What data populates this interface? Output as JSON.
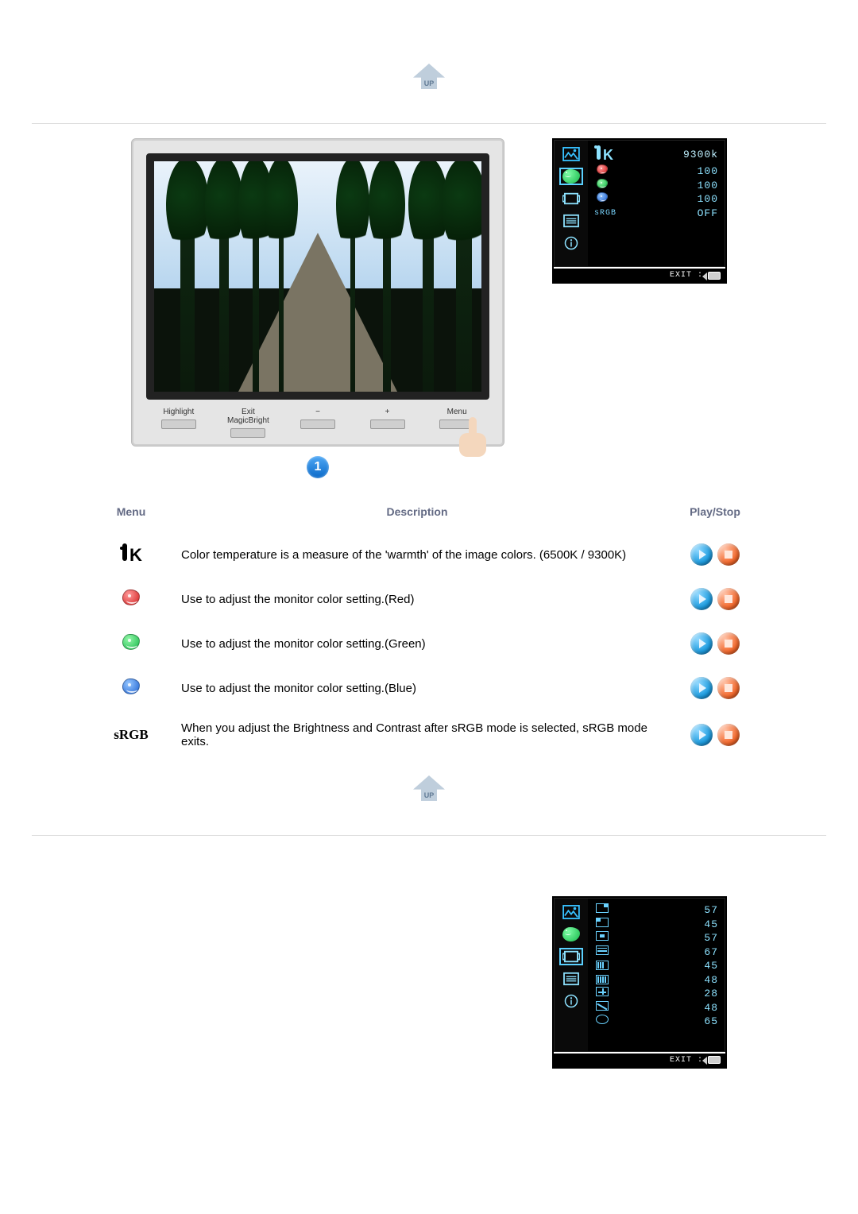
{
  "sectionUpLink": "UP",
  "monitorButtons": [
    "Highlight",
    "Exit\nMagicBright",
    "−",
    "+",
    "Menu"
  ],
  "monitorCallout": "1",
  "osdColor": {
    "exitLabel": "EXIT :",
    "rows": [
      {
        "icon": "ik",
        "value": "9300k",
        "selected": true
      },
      {
        "icon": "red",
        "value": "100"
      },
      {
        "icon": "green",
        "value": "100"
      },
      {
        "icon": "blue",
        "value": "100"
      },
      {
        "icon": "srgb",
        "label": "sRGB",
        "value": "OFF"
      }
    ]
  },
  "table": {
    "headers": [
      "Menu",
      "Description",
      "Play/Stop"
    ],
    "rows": [
      {
        "menuIcon": "ik",
        "desc": "Color temperature is a measure of the 'warmth' of the image colors. (6500K / 9300K)"
      },
      {
        "menuIcon": "red",
        "desc": "Use to adjust the monitor color setting.(Red)"
      },
      {
        "menuIcon": "green",
        "desc": "Use to adjust the monitor color setting.(Green)"
      },
      {
        "menuIcon": "blue",
        "desc": "Use to adjust the monitor color setting.(Blue)"
      },
      {
        "menuIcon": "srgb",
        "label": "sRGB",
        "desc": "When you adjust the Brightness and Contrast after sRGB mode is selected, sRGB mode exits."
      }
    ]
  },
  "osdImage": {
    "exitLabel": "EXIT :",
    "values": [
      "57",
      "45",
      "57",
      "67",
      "45",
      "48",
      "28",
      "48",
      "65"
    ]
  }
}
